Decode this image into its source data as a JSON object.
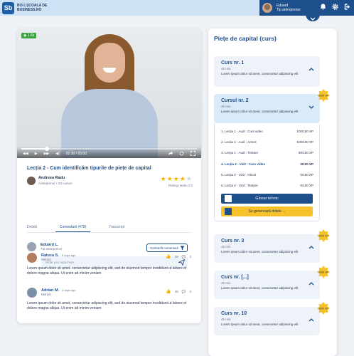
{
  "brand": {
    "logo_letters": "Sb",
    "line1": "BOI | ȘCOALA DE",
    "line2": "BUSINESS.RO"
  },
  "user": {
    "name": "Eduard",
    "role": "Tip antreprenor"
  },
  "video": {
    "badge": "1.6k",
    "time_current": "02:30",
    "time_total": "05:00",
    "progress_percent": 14
  },
  "lesson": {
    "title": "Lecția 2 - Cum identificăm tipurile de piețe de capital",
    "author_name": "Andreea Radu",
    "author_role": "Antreprenor • 23 cursuri",
    "rating": 4,
    "rating_note": "Rating mediu 4.0"
  },
  "tabs": [
    "Detalii",
    "Comentarii (479)",
    "Transcript"
  ],
  "comment_form": {
    "user_name": "Eduard L.",
    "user_role": "Tip antreprenor",
    "sort_label": "Sortează comentarii",
    "placeholder": "Write you reply here"
  },
  "comments": [
    {
      "name": "Raluca S.",
      "time": "5 days ago",
      "role": "Mentor",
      "text": "Lorem ipsum dolor sit amet, consectetur adipiscing elit, sed do eiusmod tempor incididunt ut labore et dolore magna aliqua. Ut enim ad minim veniam",
      "likes": "36",
      "replies": "3"
    },
    {
      "name": "Adrian M.",
      "time": "4 days ago",
      "role": "Mentor",
      "text": "Lorem ipsum dolor sit amet, consectetur adipiscing elit, sed do eiusmod tempor incididunt ut labore et dolore magna aliqua. Ut enim ad minim veniam",
      "likes": "36",
      "replies": "3"
    }
  ],
  "panel": {
    "title": "Piețe de capital (curs)",
    "courses": [
      {
        "name": "Curs nr. 1",
        "duration": "45 min",
        "desc": "Lorem ipsum dolor sit amet, consectetur adipiscing elit"
      },
      {
        "name": "Cursul nr. 2",
        "duration": "45 min",
        "desc": "Lorem ipsum dolor sit amet, consectetur adipiscing elit",
        "medal": "1000 XP"
      },
      {
        "name": "Curs nr. 3",
        "duration": "45 min",
        "desc": "Lorem ipsum dolor sit amet, consectetur adipiscing elit",
        "medal": "1000 XP"
      },
      {
        "name": "Curs nr. [...]",
        "duration": "45 min",
        "desc": "Lorem ipsum dolor sit amet, consectetur adipiscing elit",
        "medal": "1000 XP"
      },
      {
        "name": "Curs nr. 10",
        "duration": "45 min",
        "desc": "Lorem ipsum dolor sit amet, consectetur adipiscing elit",
        "medal": "1000 XP"
      }
    ],
    "lessons": [
      {
        "label": "1.  Lecția 1 - Audi : Curs video",
        "xp": "100/100 XP"
      },
      {
        "label": "2.  Lecția 2 - Audi : Articol",
        "xp": "100/100 XP"
      },
      {
        "label": "3.  Lecția 1 - Audi : Testare",
        "xp": "80/100 XP"
      },
      {
        "label": "4.  Lecția 2 - Vizit : Curs video",
        "xp": "0/100 XP"
      },
      {
        "label": "5.  Lecția 2 - Vizit : Articol",
        "xp": "0/100 XP"
      },
      {
        "label": "6.  Lecția 2 - Vizit : Testare",
        "xp": "0/100 XP"
      }
    ],
    "btn_glossary": "Glosar tehnic",
    "btn_generating": "Se generează dotele ..."
  },
  "colors": {
    "primary": "#1d4f8c",
    "accent": "#f6c12b",
    "success": "#3ba33f"
  }
}
